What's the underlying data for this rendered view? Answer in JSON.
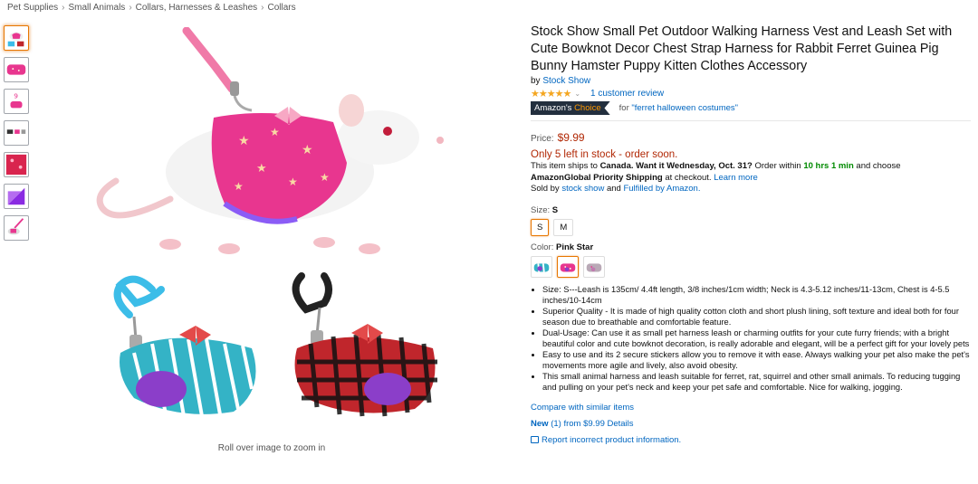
{
  "breadcrumb": [
    "Pet Supplies",
    "Small Animals",
    "Collars, Harnesses & Leashes",
    "Collars"
  ],
  "product": {
    "title": "Stock Show Small Pet Outdoor Walking Harness Vest and Leash Set with Cute Bowknot Decor Chest Strap Harness for Rabbit Ferret Guinea Pig Bunny Hamster Puppy Kitten Clothes Accessory",
    "by_prefix": "by",
    "brand": "Stock Show",
    "stars": "★★★★★",
    "rating": 5,
    "review_link": "1 customer review",
    "choice_badge_a": "Amazon's",
    "choice_badge_b": "Choice",
    "choice_for_prefix": "for",
    "choice_for_term": "\"ferret halloween costumes\"",
    "price_label": "Price:",
    "price": "$9.99",
    "stock": "Only 5 left in stock - order soon.",
    "ships_1": "This item ships to",
    "ships_country": "Canada.",
    "ships_want": "Want it Wednesday, Oct. 31?",
    "ships_order": "Order within",
    "ships_time": "10 hrs 1 min",
    "ships_choose": "and choose",
    "ships_global": "AmazonGlobal Priority Shipping",
    "ships_checkout": "at checkout.",
    "ships_learn": "Learn more",
    "sold_by_prefix": "Sold by",
    "seller": "stock show",
    "sold_and": "and",
    "fulfilled": "Fulfilled by Amazon.",
    "size_label": "Size:",
    "size_selected": "S",
    "sizes": [
      "S",
      "M"
    ],
    "color_label": "Color:",
    "color_selected": "Pink Star",
    "bullets": [
      "Size: S---Leash is 135cm/ 4.4ft length, 3/8 inches/1cm width; Neck is 4.3-5.12 inches/11-13cm, Chest is 4-5.5 inches/10-14cm",
      "Superior Quality - It is made of high quality cotton cloth and short plush lining, soft texture and ideal both for four season due to breathable and comfortable feature.",
      "Dual-Usage: Can use it as small pet harness leash or charming outfits for your cute furry friends; with a bright beautiful color and cute bowknot decoration, is really adorable and elegant, will be a perfect gift for your lovely pets",
      "Easy to use and its 2 secure stickers allow you to remove it with ease. Always walking your pet also make the pet's movements more agile and lively, also avoid obesity.",
      "This small animal harness and leash suitable for ferret, rat, squirrel and other small animals. To reducing tugging and pulling on your pet's neck and keep your pet safe and comfortable. Nice for walking, jogging."
    ],
    "compare": "Compare with similar items",
    "new_label": "New",
    "new_rest": "(1) from $9.99 Details",
    "report": "Report incorrect product information."
  },
  "image": {
    "zoom_hint": "Roll over image to zoom in"
  },
  "icons": {
    "chevron": "chevron-down-icon",
    "report": "report-icon"
  },
  "colors": {
    "link": "#0066c0",
    "price": "#b12704",
    "star": "#f4a620",
    "badge_bg": "#232f3e",
    "badge_accent": "#ff9900",
    "green": "#008a00",
    "select_border": "#e77600"
  }
}
